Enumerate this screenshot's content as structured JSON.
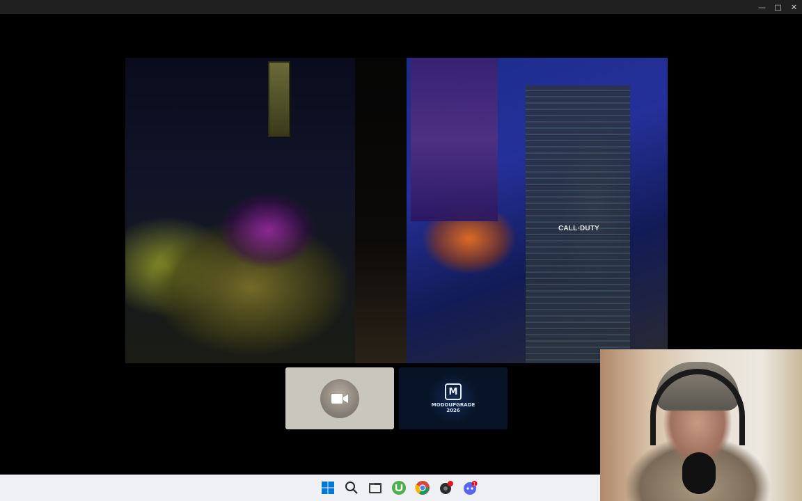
{
  "window": {
    "controls": {
      "minimize": "—",
      "maximize": "□",
      "close": "✕"
    }
  },
  "main_video": {
    "scene_text": "CALL·DUTY"
  },
  "participants": [
    {
      "type": "camera-off",
      "icon": "video-camera-icon"
    },
    {
      "type": "logo",
      "icon": "m-logo-icon",
      "logo_letter": "M",
      "logo_text": "MODOUPGRADE\n2026"
    }
  ],
  "taskbar": {
    "background": "#eef0f4",
    "items": [
      {
        "name": "windows-start-icon"
      },
      {
        "name": "search-icon"
      },
      {
        "name": "file-explorer-icon"
      },
      {
        "name": "utorrent-icon"
      },
      {
        "name": "chrome-icon"
      },
      {
        "name": "screen-recorder-icon"
      },
      {
        "name": "discord-icon",
        "badge": "1"
      }
    ]
  },
  "colors": {
    "titlebar": "#202020",
    "stage": "#000000",
    "accent_blue": "#0078d4",
    "discord": "#5865f2",
    "badge_red": "#e81123"
  }
}
